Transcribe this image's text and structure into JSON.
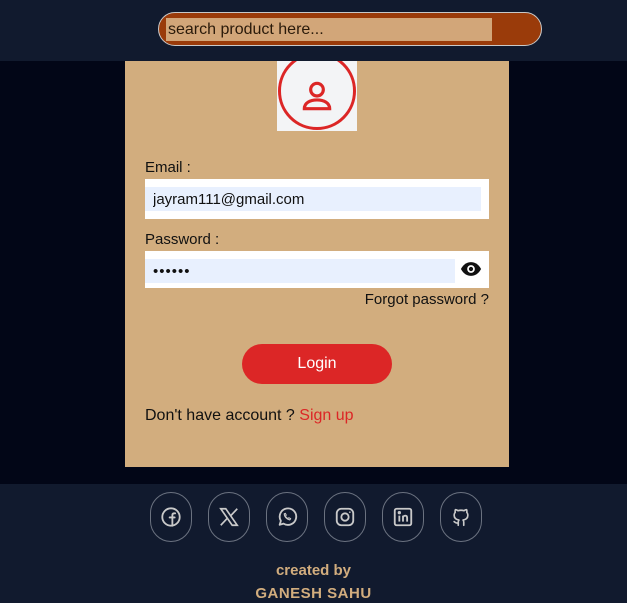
{
  "search": {
    "placeholder": "search product here...",
    "icon": "search-icon"
  },
  "login": {
    "avatar_icon": "user-icon",
    "email_label": "Email :",
    "email_value": "jayram111@gmail.com",
    "password_label": "Password :",
    "password_value": "••••••",
    "show_password_icon": "eye-icon",
    "forgot_label": "Forgot password ?",
    "login_label": "Login",
    "no_account_text": "Don't have account ? ",
    "signup_label": "Sign up"
  },
  "footer": {
    "socials": [
      "facebook-icon",
      "x-icon",
      "whatsapp-icon",
      "instagram-icon",
      "linkedin-icon",
      "github-icon"
    ],
    "created_by": "created by",
    "author": "GANESH SAHU"
  },
  "colors": {
    "header_bg": "#111a2e",
    "card_bg": "#d2ad7e",
    "accent": "#dc2626",
    "search_border": "#9a3b0a"
  }
}
